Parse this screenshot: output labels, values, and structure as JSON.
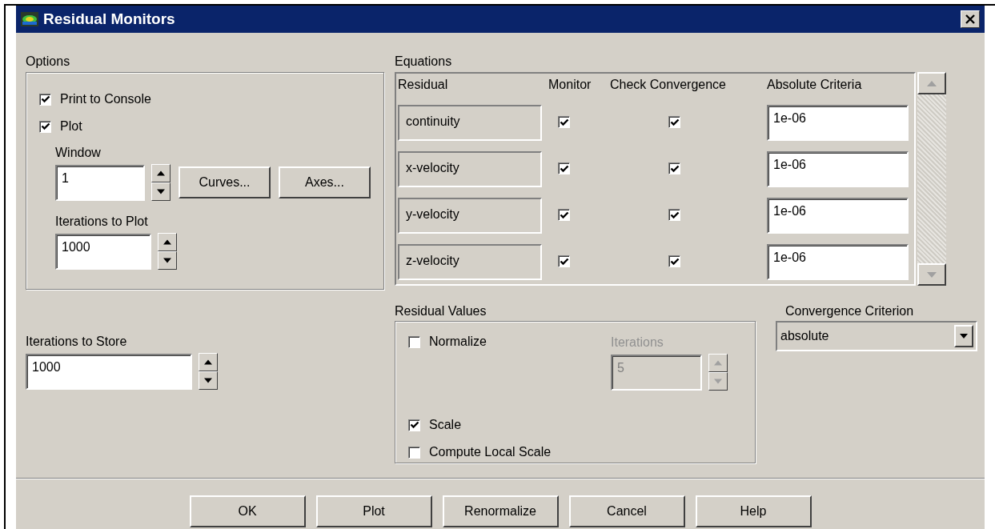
{
  "window": {
    "title": "Residual Monitors"
  },
  "options": {
    "label": "Options",
    "print_to_console": {
      "label": "Print to Console",
      "checked": true
    },
    "plot": {
      "label": "Plot",
      "checked": true
    },
    "window": {
      "label": "Window",
      "value": "1"
    },
    "curves_button": "Curves...",
    "axes_button": "Axes...",
    "iterations_to_plot": {
      "label": "Iterations to Plot",
      "value": "1000"
    }
  },
  "iterations_to_store": {
    "label": "Iterations to Store",
    "value": "1000"
  },
  "equations": {
    "label": "Equations",
    "columns": [
      "Residual",
      "Monitor",
      "Check Convergence",
      "Absolute Criteria"
    ],
    "rows": [
      {
        "residual": "continuity",
        "monitor": true,
        "check_convergence": true,
        "absolute_criteria": "1e-06"
      },
      {
        "residual": "x-velocity",
        "monitor": true,
        "check_convergence": true,
        "absolute_criteria": "1e-06"
      },
      {
        "residual": "y-velocity",
        "monitor": true,
        "check_convergence": true,
        "absolute_criteria": "1e-06"
      },
      {
        "residual": "z-velocity",
        "monitor": true,
        "check_convergence": true,
        "absolute_criteria": "1e-06"
      }
    ]
  },
  "residual_values": {
    "label": "Residual Values",
    "normalize": {
      "label": "Normalize",
      "checked": false
    },
    "iterations": {
      "label": "Iterations",
      "value": "5",
      "disabled": true
    },
    "scale": {
      "label": "Scale",
      "checked": true
    },
    "compute_local_scale": {
      "label": "Compute Local Scale",
      "checked": false
    }
  },
  "convergence_criterion": {
    "label": "Convergence Criterion",
    "value": "absolute"
  },
  "buttons": [
    "OK",
    "Plot",
    "Renormalize",
    "Cancel",
    "Help"
  ]
}
